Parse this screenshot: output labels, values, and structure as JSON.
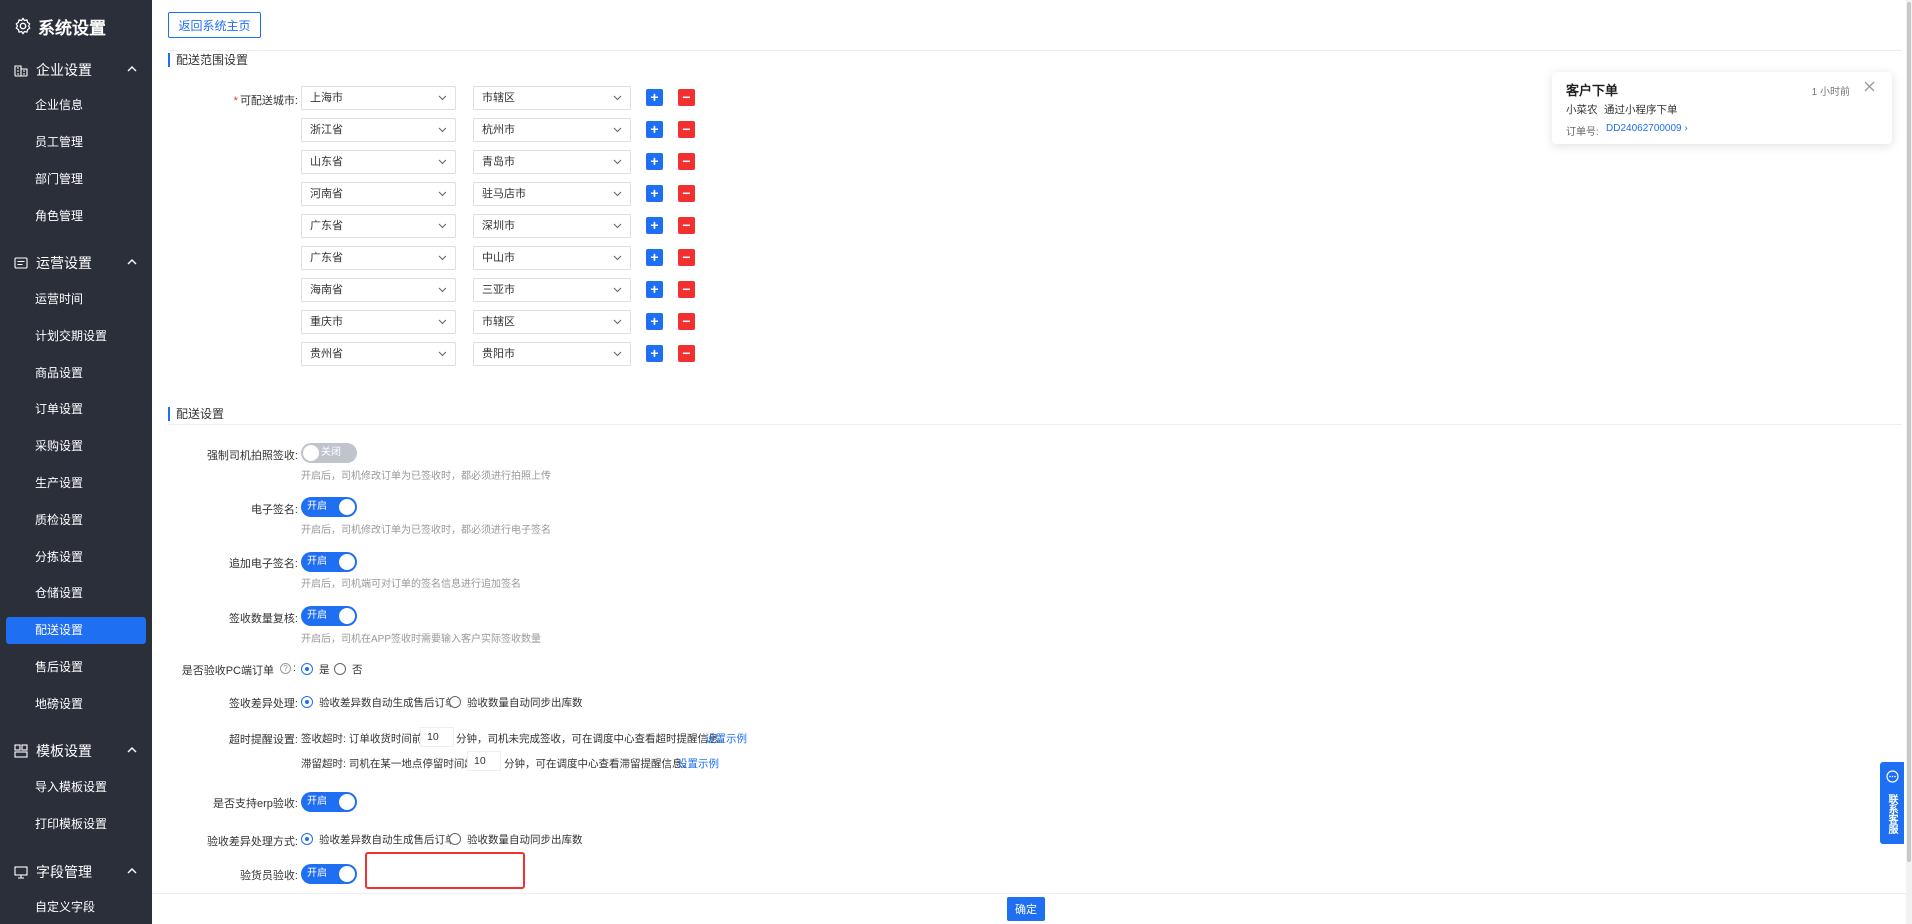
{
  "sidebar": {
    "title": "系统设置",
    "groups": [
      {
        "label": "企业设置",
        "items": [
          "企业信息",
          "员工管理",
          "部门管理",
          "角色管理"
        ]
      },
      {
        "label": "运营设置",
        "items": [
          "运营时间",
          "计划交期设置",
          "商品设置",
          "订单设置",
          "采购设置",
          "生产设置",
          "质检设置",
          "分拣设置",
          "仓储设置",
          "配送设置",
          "售后设置",
          "地磅设置"
        ]
      },
      {
        "label": "模板设置",
        "items": [
          "导入模板设置",
          "打印模板设置"
        ]
      },
      {
        "label": "字段管理",
        "items": [
          "自定义字段"
        ]
      }
    ],
    "active_item": "配送设置"
  },
  "header": {
    "back_label": "返回系统主页"
  },
  "range_section": {
    "title": "配送范围设置",
    "label": "可配送城市:",
    "rows": [
      {
        "province": "上海市",
        "city": "市辖区"
      },
      {
        "province": "浙江省",
        "city": "杭州市"
      },
      {
        "province": "山东省",
        "city": "青岛市"
      },
      {
        "province": "河南省",
        "city": "驻马店市"
      },
      {
        "province": "广东省",
        "city": "深圳市"
      },
      {
        "province": "广东省",
        "city": "中山市"
      },
      {
        "province": "海南省",
        "city": "三亚市"
      },
      {
        "province": "重庆市",
        "city": "市辖区"
      },
      {
        "province": "贵州省",
        "city": "贵阳市"
      }
    ],
    "add_symbol": "+",
    "remove_symbol": "−"
  },
  "delivery_section": {
    "title": "配送设置",
    "force_photo": {
      "label": "强制司机拍照签收:",
      "state": "关闭",
      "hint": "开启后，司机修改订单为已签收时，都必须进行拍照上传"
    },
    "e_sign": {
      "label": "电子签名:",
      "state": "开启",
      "hint": "开启后，司机修改订单为已签收时，都必须进行电子签名"
    },
    "add_sign": {
      "label": "追加电子签名:",
      "state": "开启",
      "hint": "开启后，司机端可对订单的签名信息进行追加签名"
    },
    "qty_review": {
      "label": "签收数量复核:",
      "state": "开启",
      "hint": "开启后，司机在APP签收时需要输入客户实际签收数量"
    },
    "pc_check": {
      "label": "是否验收PC端订单",
      "help": "?",
      "colon": ":",
      "yes": "是",
      "no": "否"
    },
    "diff_process": {
      "label": "签收差异处理:",
      "option1": "验收差异数自动生成售后订单",
      "option2": "验收数量自动同步出库数"
    },
    "timeout": {
      "label": "超时提醒设置:",
      "sign_prefix": "签收超时:  订单收货时间前",
      "sign_value": "10",
      "sign_suffix": "分钟，司机未完成签收，可在调度中心查看超时提醒信息。",
      "sign_link": "设置示例",
      "stay_prefix": "滞留超时:  司机在某一地点停留时间超",
      "stay_value": "10",
      "stay_suffix": "分钟，可在调度中心查看滞留提醒信息。",
      "stay_link": "设置示例"
    },
    "erp_check": {
      "label": "是否支持erp验收:",
      "state": "开启"
    },
    "check_diff": {
      "label": "验收差异处理方式:",
      "option1": "验收差异数自动生成售后订单",
      "option2": "验收数量自动同步出库数"
    },
    "inspector_check": {
      "label": "验货员验收:",
      "state": "开启"
    }
  },
  "footer": {
    "confirm_label": "确定"
  },
  "notification": {
    "title": "客户下单",
    "time": "1 小时前",
    "customer": "小菜农",
    "source": "通过小程序下单",
    "order_label": "订单号:",
    "order_no": "DD24062700009",
    "order_arrow": "›"
  },
  "contact": {
    "label": "联系客服"
  },
  "colors": {
    "primary": "#1f6ff2",
    "danger": "#f23030",
    "sidebar_bg": "#2b2f3a"
  }
}
